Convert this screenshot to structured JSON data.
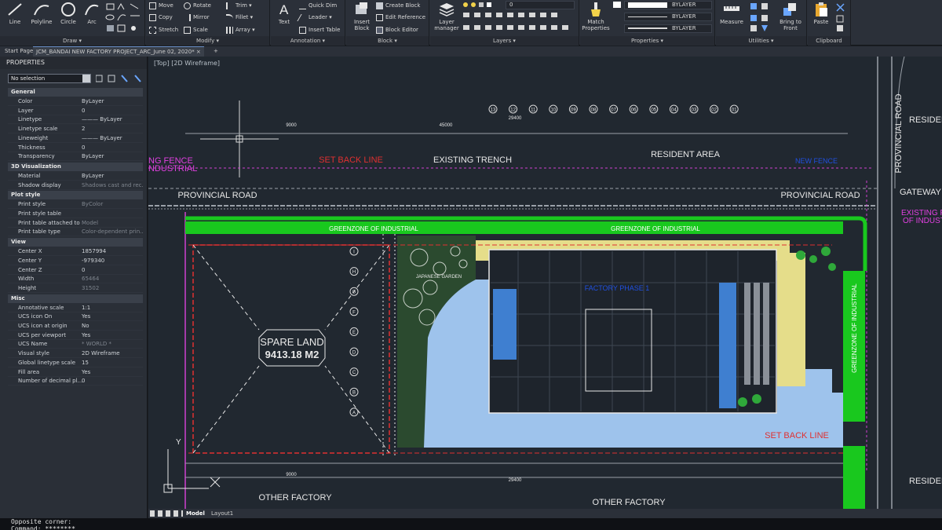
{
  "ribbon": {
    "draw": {
      "title": "Draw ▾",
      "line": "Line",
      "polyline": "Polyline",
      "circle": "Circle",
      "arc": "Arc"
    },
    "modify": {
      "title": "Modify ▾",
      "move": "Move",
      "rotate": "Rotate",
      "trim": "Trim ▾",
      "copy": "Copy",
      "mirror": "Mirror",
      "fillet": "Fillet ▾",
      "stretch": "Stretch",
      "scale": "Scale",
      "array": "Array ▾"
    },
    "annotation": {
      "title": "Annotation ▾",
      "text": "Text",
      "quick_dim": "Quick Dim",
      "leader": "Leader ▾",
      "insert_table": "Insert Table"
    },
    "block": {
      "title": "Block ▾",
      "insert_block": "Insert Block",
      "create_block": "Create Block",
      "edit_reference": "Edit Reference",
      "block_editor": "Block Editor"
    },
    "layers": {
      "title": "Layers ▾",
      "layer_manager": "Layer manager",
      "current_layer": "0"
    },
    "properties": {
      "title": "Properties ▾",
      "match": "Match Properties",
      "color": "BYLAYER",
      "linetype": "BYLAYER",
      "lineweight": "BYLAYER"
    },
    "utilities": {
      "title": "Utilities ▾",
      "measure": "Measure",
      "bring_front": "Bring to Front"
    },
    "clipboard": {
      "title": "Clipboard",
      "paste": "Paste"
    }
  },
  "tabs": {
    "start": "Start Page",
    "document": "JCM_BANDAI NEW FACTORY PROJECT_ARC_June 02, 2020*",
    "close": "×",
    "add": "+"
  },
  "properties_panel": {
    "title": "PROPERTIES",
    "selection": "No selection",
    "sections": {
      "general": {
        "label": "General",
        "rows": [
          {
            "key": "Color",
            "value": "ByLayer"
          },
          {
            "key": "Layer",
            "value": "0"
          },
          {
            "key": "Linetype",
            "value": "——— ByLayer"
          },
          {
            "key": "Linetype scale",
            "value": "2"
          },
          {
            "key": "Lineweight",
            "value": "——— ByLayer"
          },
          {
            "key": "Thickness",
            "value": "0"
          },
          {
            "key": "Transparency",
            "value": "ByLayer"
          }
        ]
      },
      "viz": {
        "label": "3D Visualization",
        "rows": [
          {
            "key": "Material",
            "value": "ByLayer"
          },
          {
            "key": "Shadow display",
            "value": "Shadows cast and rec..."
          }
        ]
      },
      "plot": {
        "label": "Plot style",
        "rows": [
          {
            "key": "Print style",
            "value": "ByColor"
          },
          {
            "key": "Print style table",
            "value": ""
          },
          {
            "key": "Print table attached to",
            "value": "Model"
          },
          {
            "key": "Print table type",
            "value": "Color-dependent prin..."
          }
        ]
      },
      "view": {
        "label": "View",
        "rows": [
          {
            "key": "Center X",
            "value": "1857994"
          },
          {
            "key": "Center Y",
            "value": "-979340"
          },
          {
            "key": "Center Z",
            "value": "0"
          },
          {
            "key": "Width",
            "value": "65464"
          },
          {
            "key": "Height",
            "value": "31502"
          }
        ]
      },
      "misc": {
        "label": "Misc",
        "rows": [
          {
            "key": "Annotative scale",
            "value": "1:1"
          },
          {
            "key": "UCS icon On",
            "value": "Yes"
          },
          {
            "key": "UCS icon at origin",
            "value": "No"
          },
          {
            "key": "UCS per viewport",
            "value": "Yes"
          },
          {
            "key": "UCS Name",
            "value": "* WORLD *"
          },
          {
            "key": "Visual style",
            "value": "2D Wireframe"
          },
          {
            "key": "Global linetype scale",
            "value": "15"
          },
          {
            "key": "Fill area",
            "value": "Yes"
          },
          {
            "key": "Number of decimal pl...",
            "value": "0"
          }
        ]
      }
    }
  },
  "viewport": {
    "label": "[Top] [2D Wireframe]"
  },
  "drawing": {
    "provincial_road": "PROVINCIAL ROAD",
    "provincial_road_vertical": "PROVINCIAL ROAD",
    "resident_area": "RESIDENT AREA",
    "resident": "RESIDEN",
    "existing_trench": "EXISTING TRENCH",
    "setback_top": "SET BACK LINE",
    "setback_bottom": "SET BACK LINE",
    "fence_left_1": "NG FENCE",
    "fence_left_2": "NDUSTRIAL",
    "existing_right_1": "EXISTING FE",
    "existing_right_2": "OF INDUST",
    "greenzone_1": "GREENZONE OF INDUSTRIAL",
    "greenzone_2": "GREENZONE OF INDUSTRIAL",
    "greenzone_vertical": "GREENZONE OF INDUSTRIAL",
    "gateway": "GATEWAY I",
    "japanese_garden": "JAPANESE GARDEN",
    "spare_land_1": "SPARE LAND",
    "spare_land_2": "9413.18 M2",
    "other_factory_left": "OTHER FACTORY",
    "other_factory_bottom": "OTHER FACTORY",
    "dim_9000": "9000",
    "dim_45000": "45000",
    "dim_9000_bottom": "9000",
    "dim_29400": "29400",
    "column_nums": [
      "13",
      "12",
      "11",
      "10",
      "09",
      "08",
      "07",
      "06",
      "05",
      "04",
      "03",
      "02",
      "01"
    ],
    "row_letters": [
      "I",
      "H",
      "G",
      "F",
      "E",
      "D",
      "C",
      "B",
      "A"
    ],
    "ucs_x": "X",
    "ucs_y": "Y"
  },
  "layout_tabs": {
    "model": "Model",
    "layout1": "Layout1"
  },
  "command": {
    "line1": "Opposite corner:",
    "line2": "Command: ********"
  }
}
